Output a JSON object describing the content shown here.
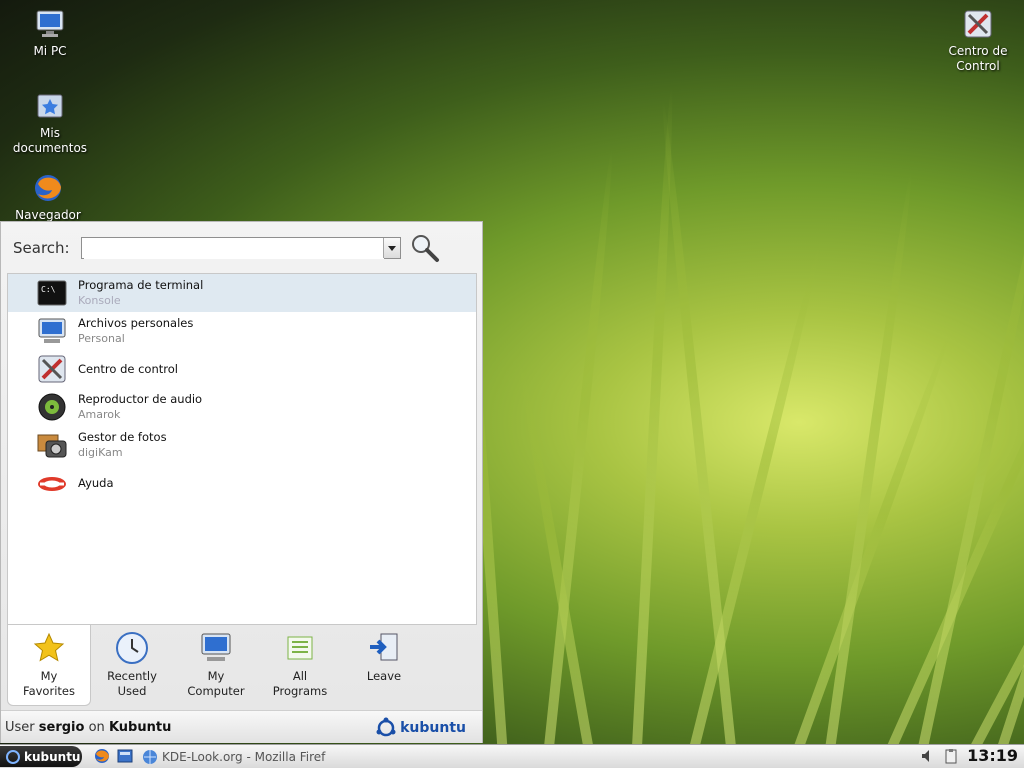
{
  "desktop": {
    "icons": [
      {
        "label_lines": [
          "Mi PC"
        ]
      },
      {
        "label_lines": [
          "Mis",
          "documentos"
        ]
      },
      {
        "label_lines": [
          "Navegador"
        ]
      },
      {
        "label_lines": [
          "Centro de",
          "Control"
        ]
      }
    ]
  },
  "menu": {
    "search_label": "Search:",
    "search_value": "",
    "items": [
      {
        "title": "Programa de terminal",
        "subtitle": "Konsole",
        "icon": "terminal-icon"
      },
      {
        "title": "Archivos personales",
        "subtitle": "Personal",
        "icon": "home-folder-icon"
      },
      {
        "title": "Centro de control",
        "subtitle": "",
        "icon": "control-center-icon"
      },
      {
        "title": "Reproductor de audio",
        "subtitle": "Amarok",
        "icon": "audio-player-icon"
      },
      {
        "title": "Gestor de fotos",
        "subtitle": "digiKam",
        "icon": "photo-manager-icon"
      },
      {
        "title": "Ayuda",
        "subtitle": "",
        "icon": "help-lifebuoy-icon"
      }
    ],
    "tabs": [
      {
        "line1": "My",
        "line2": "Favorites",
        "icon": "star-icon"
      },
      {
        "line1": "Recently",
        "line2": "Used",
        "icon": "clock-icon"
      },
      {
        "line1": "My",
        "line2": "Computer",
        "icon": "computer-icon"
      },
      {
        "line1": "All",
        "line2": "Programs",
        "icon": "list-icon"
      },
      {
        "line1": "",
        "line2": "Leave",
        "icon": "leave-icon"
      }
    ],
    "footer": {
      "user_prefix": "User",
      "username": "sergio",
      "on": "on",
      "host": "Kubuntu",
      "brand": "kubuntu"
    }
  },
  "taskbar": {
    "start_label": "kubuntu",
    "task_title": "KDE-Look.org - Mozilla Firef",
    "clock": "13:19"
  },
  "colors": {
    "accent": "#1a4fa8",
    "selection": "#dfe9f1"
  }
}
